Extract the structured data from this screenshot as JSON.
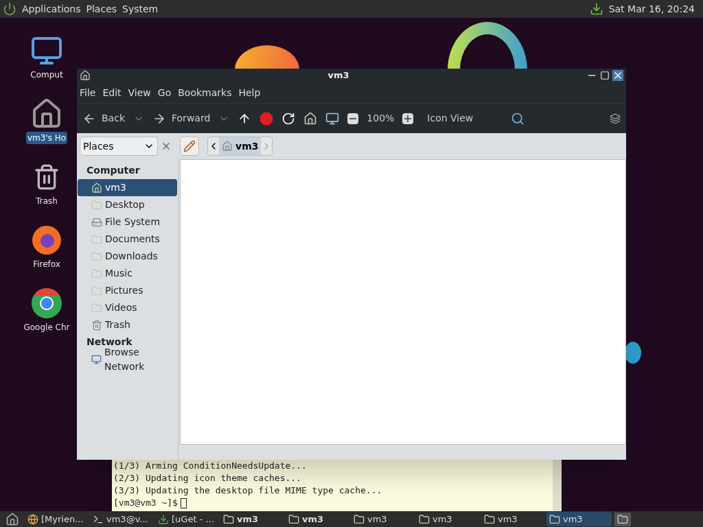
{
  "top_panel": {
    "menus": [
      "Applications",
      "Places",
      "System"
    ],
    "clock": "Sat Mar 16, 20:24"
  },
  "desktop_icons": [
    {
      "kind": "computer",
      "label": "Comput",
      "selected": false
    },
    {
      "kind": "home",
      "label": "vm3's Ho",
      "selected": true
    },
    {
      "kind": "trash",
      "label": "Trash",
      "selected": false
    },
    {
      "kind": "firefox",
      "label": "Firefox",
      "selected": false
    },
    {
      "kind": "chrome",
      "label": "Google Chr",
      "selected": false
    }
  ],
  "window": {
    "title": "vm3",
    "menu": [
      "File",
      "Edit",
      "View",
      "Go",
      "Bookmarks",
      "Help"
    ],
    "toolbar": {
      "back": "Back",
      "forward": "Forward",
      "zoom": "100%",
      "view": "Icon View"
    },
    "location": {
      "side_pane": "Places",
      "path": [
        "vm3"
      ]
    },
    "sidebar": [
      {
        "title": "Computer",
        "items": [
          {
            "kind": "home",
            "label": "vm3",
            "selected": true
          },
          {
            "kind": "folder",
            "label": "Desktop",
            "selected": false
          },
          {
            "kind": "drive",
            "label": "File System",
            "selected": false
          },
          {
            "kind": "folder",
            "label": "Documents",
            "selected": false
          },
          {
            "kind": "folder",
            "label": "Downloads",
            "selected": false
          },
          {
            "kind": "folder",
            "label": "Music",
            "selected": false
          },
          {
            "kind": "folder",
            "label": "Pictures",
            "selected": false
          },
          {
            "kind": "folder",
            "label": "Videos",
            "selected": false
          },
          {
            "kind": "trash",
            "label": "Trash",
            "selected": false
          }
        ]
      },
      {
        "title": "Network",
        "items": [
          {
            "kind": "network",
            "label": "Browse Network",
            "selected": false
          }
        ]
      }
    ]
  },
  "terminal": {
    "lines": [
      "(1/3) Arming ConditionNeedsUpdate...",
      "(2/3) Updating icon theme caches...",
      "(3/3) Updating the desktop file MIME type cache..."
    ],
    "prompt": "[vm3@vm3 ~]$"
  },
  "taskbar": [
    {
      "kind": "chrome",
      "label": "[Myrien...",
      "bold": false,
      "selected": false
    },
    {
      "kind": "terminal",
      "label": "vm3@v...",
      "bold": false,
      "selected": false
    },
    {
      "kind": "uget",
      "label": "[uGet - ...",
      "bold": false,
      "selected": false
    },
    {
      "kind": "folder",
      "label": "vm3",
      "bold": true,
      "selected": false
    },
    {
      "kind": "folder",
      "label": "vm3",
      "bold": true,
      "selected": false
    },
    {
      "kind": "folder",
      "label": "vm3",
      "bold": false,
      "selected": false
    },
    {
      "kind": "folder",
      "label": "vm3",
      "bold": false,
      "selected": false
    },
    {
      "kind": "folder",
      "label": "vm3",
      "bold": false,
      "selected": false
    },
    {
      "kind": "folder",
      "label": "vm3",
      "bold": false,
      "selected": true
    }
  ]
}
